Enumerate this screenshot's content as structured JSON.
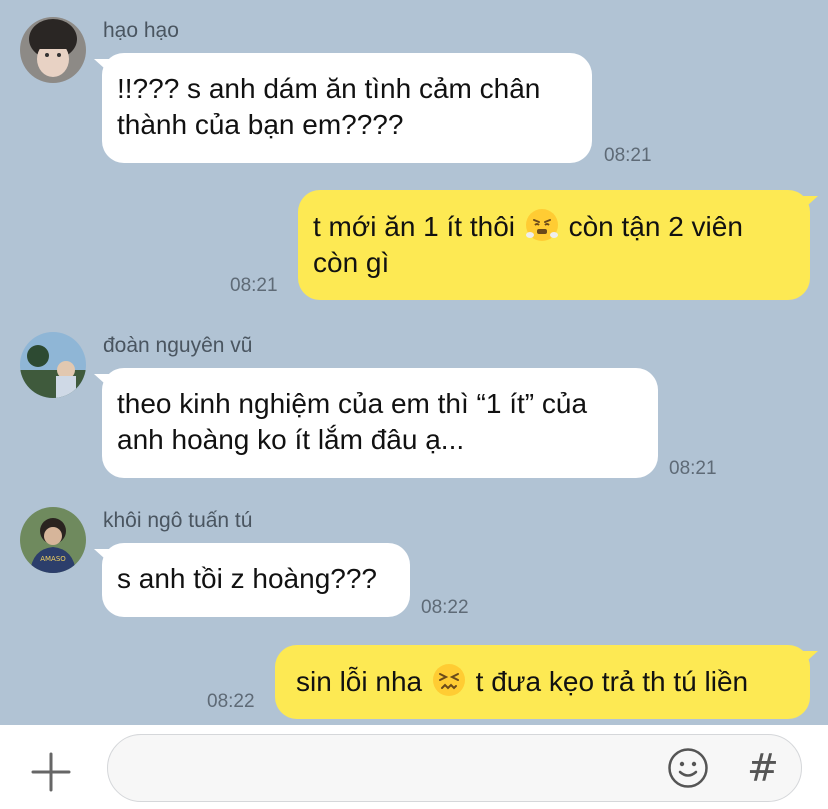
{
  "messages": [
    {
      "sender": "hạo hạo",
      "line1": "!!??? s anh dám ăn tình cảm chân",
      "line2": "thành của bạn em????",
      "time": "08:21"
    },
    {
      "sender": "",
      "part1": "t mới ăn 1 ít thôi",
      "emoji": "huffing-with-anger-face",
      "part2": "còn tận 2 viên",
      "line2": "còn gì",
      "time": "08:21"
    },
    {
      "sender": "đoàn nguyên vũ",
      "line1": "theo kinh nghiệm của em thì “1 ít” của",
      "line2": "anh hoàng ko ít lắm đâu ạ...",
      "time": "08:21"
    },
    {
      "sender": "khôi ngô tuấn tú",
      "line1": "s anh tồi z hoàng???",
      "time": "08:22"
    },
    {
      "sender": "",
      "part1": "sin lỗi nha",
      "emoji": "confounded-face",
      "part2": "t đưa kẹo trả th tú liền",
      "time": "08:22"
    }
  ],
  "input": {
    "placeholder": "",
    "hash_label": "#"
  },
  "colors": {
    "background": "#b1c3d4",
    "incoming_bubble": "#ffffff",
    "outgoing_bubble": "#fde953"
  }
}
